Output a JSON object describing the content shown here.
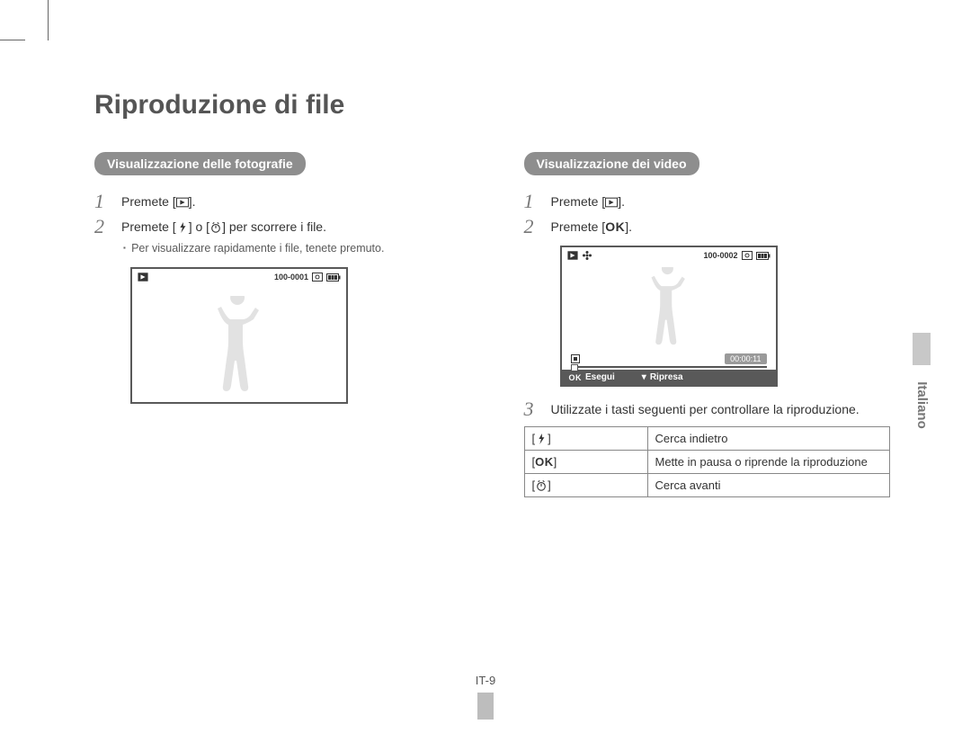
{
  "title": "Riproduzione di file",
  "language_tab": "Italiano",
  "page_number": "IT-9",
  "left": {
    "pill": "Visualizzazione delle fotografie",
    "step1_a": "Premete [",
    "step1_b": "].",
    "step2_a": "Premete [",
    "step2_mid": "] o [",
    "step2_b": "] per scorrere i file.",
    "sub": "Per visualizzare rapidamente i file, tenete premuto.",
    "screen_file": "100-0001"
  },
  "right": {
    "pill": "Visualizzazione dei video",
    "step1_a": "Premete [",
    "step1_b": "].",
    "step2_a": "Premete [",
    "step2_b": "].",
    "step3": "Utilizzate i tasti seguenti per controllare la riproduzione.",
    "screen_file": "100-0002",
    "screen_time": "00:00:11",
    "screen_ok": "Esegui",
    "screen_down": "Ripresa",
    "table": {
      "r1": "Cerca indietro",
      "r2": "Mette in pausa o riprende la riproduzione",
      "r3": "Cerca avanti"
    }
  }
}
